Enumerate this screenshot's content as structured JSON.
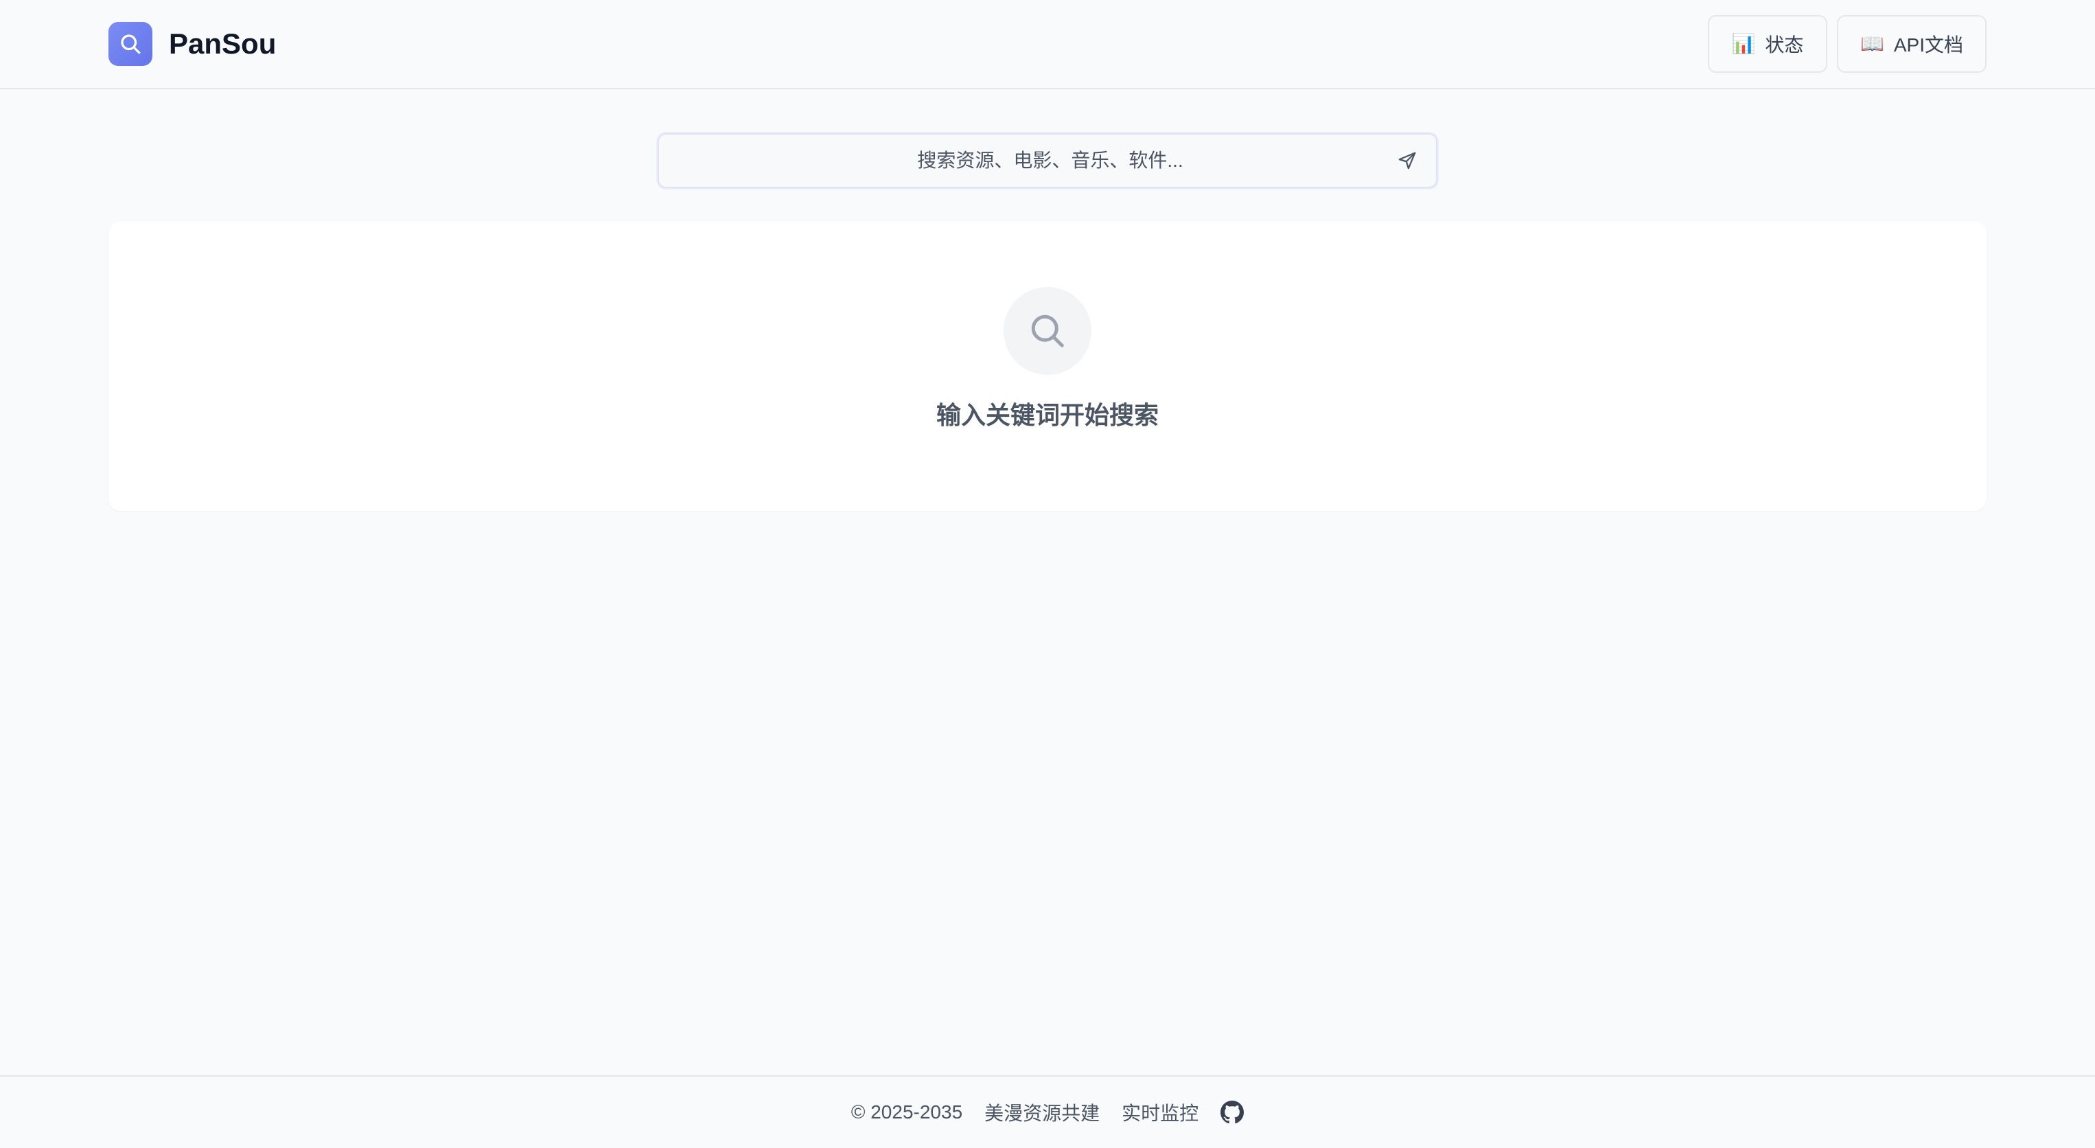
{
  "header": {
    "brand": "PanSou",
    "buttons": {
      "status_icon": "📊",
      "status_label": "状态",
      "api_icon": "📖",
      "api_label": "API文档"
    }
  },
  "search": {
    "placeholder": "搜索资源、电影、音乐、软件..."
  },
  "empty_state": {
    "icon": "search-icon",
    "message": "输入关键词开始搜索"
  },
  "footer": {
    "copyright": "© 2025-2035",
    "link_community": "美漫资源共建",
    "link_monitor": "实时监控",
    "github_icon": "github-icon"
  },
  "colors": {
    "accent": "#6d7ff0",
    "background": "#f9fafb",
    "card": "#ffffff",
    "border": "#e5e7eb"
  }
}
